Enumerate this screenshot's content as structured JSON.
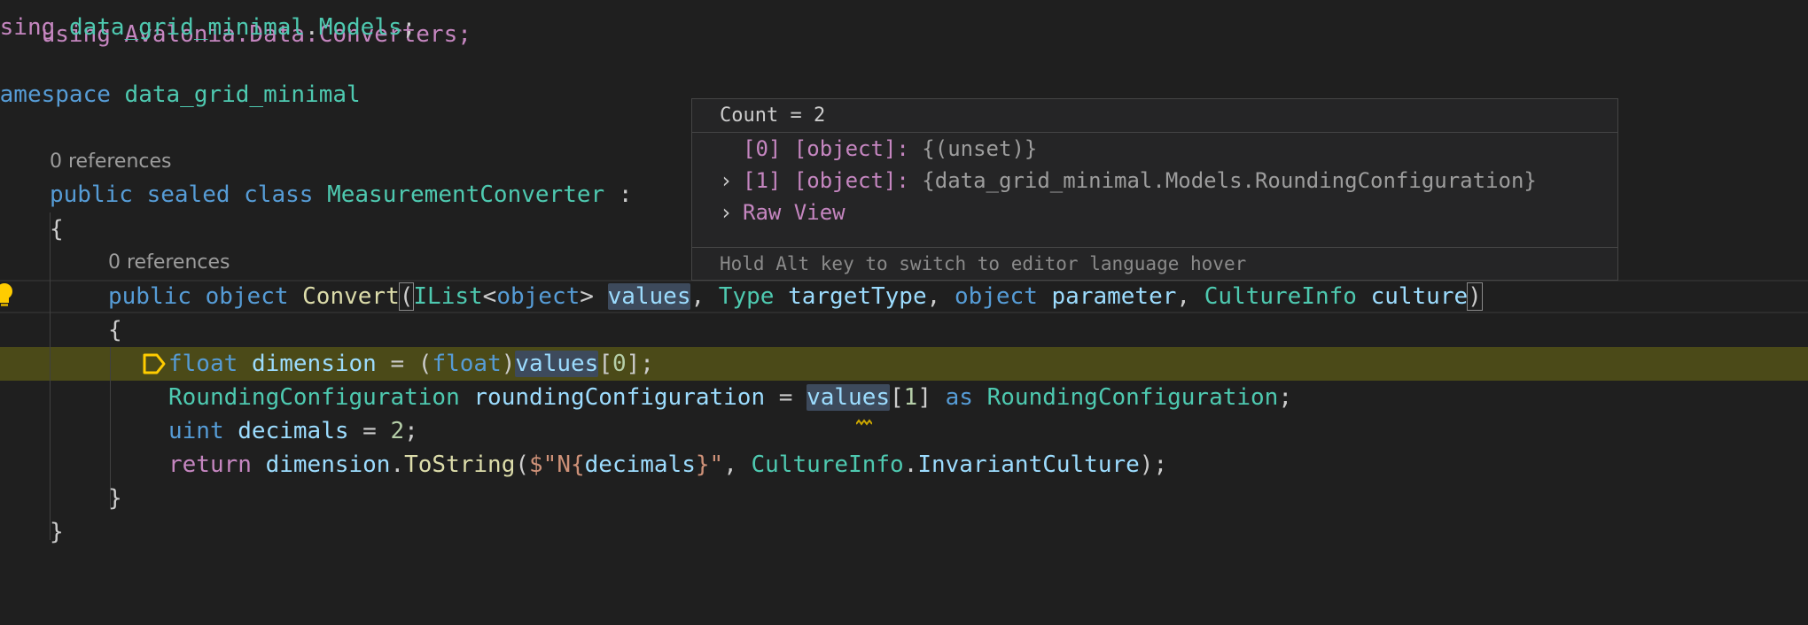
{
  "code_lens": {
    "class_refs": "0 references",
    "method_refs": "0 references"
  },
  "lines": {
    "l0": "using Avalonia.Data.Converters;",
    "l1_kw": "using",
    "l1_ns": "data_grid_minimal",
    "l1_dot": ".",
    "l1_ns2": "Models",
    "l1_end": ";",
    "l3_kw": "namespace",
    "l3_ns": "data_grid_minimal",
    "l4": "{",
    "l6_pub": "public",
    "l6_sealed": "sealed",
    "l6_class": "class",
    "l6_name": "MeasurementConverter",
    "l6_colon": " :",
    "l7": "{",
    "l9_pub": "public",
    "l9_obj": "object",
    "l9_fn": "Convert",
    "l9_p1": "(",
    "l9_ilist": "IList",
    "l9_lt": "<",
    "l9_obj2": "object",
    "l9_gt": "> ",
    "l9_values": "values",
    "l9_c1": ", ",
    "l9_type": "Type",
    "l9_target": "targetType",
    "l9_c2": ", ",
    "l9_obj3": "object",
    "l9_param": "parameter",
    "l9_c3": ", ",
    "l9_ci": "CultureInfo",
    "l9_culture": "culture",
    "l9_p2": ")",
    "l10": "{",
    "l11_float": "float",
    "l11_dim": "dimension",
    "l11_eq": " = (",
    "l11_float2": "float",
    "l11_cp": ")",
    "l11_values": "values",
    "l11_idx": "[",
    "l11_zero": "0",
    "l11_end": "];",
    "l12_type": "RoundingConfiguration",
    "l12_var": "roundingConfiguration",
    "l12_eq": " = ",
    "l12_values": "values",
    "l12_idx": "[",
    "l12_one": "1",
    "l12_close": "] ",
    "l12_as": "as",
    "l12_type2": "RoundingConfiguration",
    "l12_end": ";",
    "l13_uint": "uint",
    "l13_dec": "decimals",
    "l13_eq": " = ",
    "l13_two": "2",
    "l13_end": ";",
    "l14_return": "return",
    "l14_dim": "dimension",
    "l14_dot": ".",
    "l14_fn": "ToString",
    "l14_p": "(",
    "l14_s1": "$\"N{",
    "l14_dec": "decimals",
    "l14_s2": "}\"",
    "l14_c": ", ",
    "l14_ci": "CultureInfo",
    "l14_dot2": ".",
    "l14_inv": "InvariantCulture",
    "l14_end": ");",
    "l15": "}",
    "l16": "}",
    "l17": "}"
  },
  "hover": {
    "header": "Count = 2",
    "items": [
      {
        "name": "[0] [object]:",
        "value": "{(unset)}",
        "expandable": false
      },
      {
        "name": "[1] [object]:",
        "value": "{data_grid_minimal.Models.RoundingConfiguration}",
        "expandable": true
      },
      {
        "name": "Raw View",
        "value": "",
        "expandable": true
      }
    ],
    "chevron": "›",
    "footer": "Hold Alt key to switch to editor language hover"
  },
  "colors": {
    "background": "#1f1f1f",
    "current_line": "#4b4a18",
    "keyword": "#569cd6",
    "type": "#4ec9b0",
    "function": "#dcdcaa",
    "identifier": "#9cdcfe",
    "control": "#c586c0"
  },
  "icons": {
    "lightbulb": "lightbulb-icon",
    "breakpoint": "breakpoint-arrow-icon"
  }
}
